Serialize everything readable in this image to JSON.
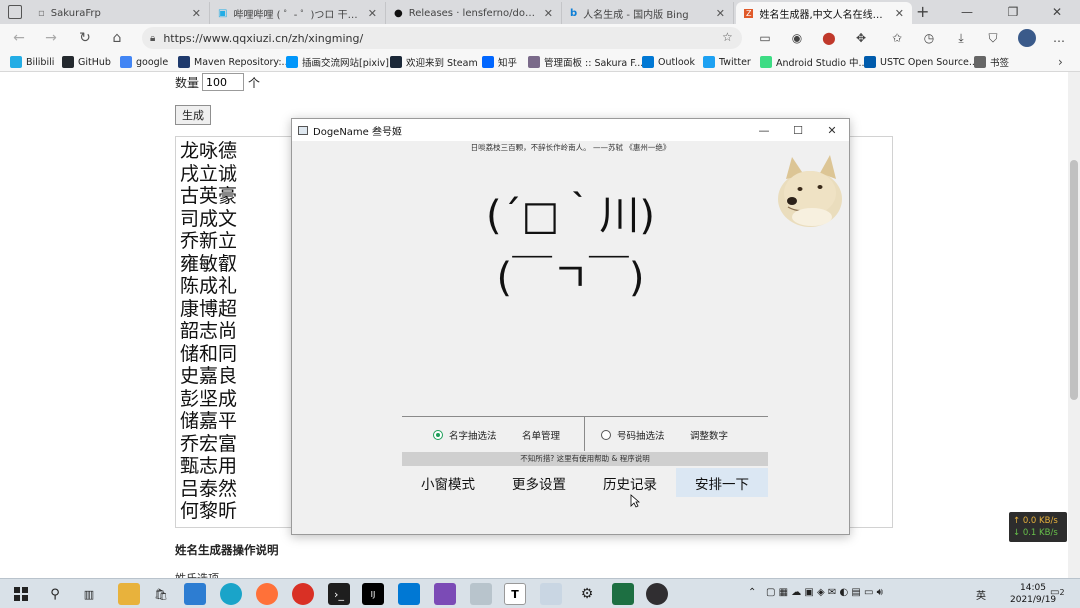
{
  "browser": {
    "tabs": [
      {
        "title": "SakuraFrp",
        "active": false
      },
      {
        "title": "哔哩哔哩 ( ゜- ゜)つロ 干杯~-bili",
        "active": false
      },
      {
        "title": "Releases · lensferno/dogename",
        "active": false
      },
      {
        "title": "人名生成 - 国内版 Bing",
        "active": false
      },
      {
        "title": "姓名生成器,中文人名在线生成,可",
        "active": true
      }
    ],
    "url": "https://www.qqxiuzi.cn/zh/xingming/",
    "bookmarks": [
      {
        "label": "Bilibili",
        "color": "#23ade5"
      },
      {
        "label": "GitHub",
        "color": "#24292e"
      },
      {
        "label": "google",
        "color": "#4285f4"
      },
      {
        "label": "Maven Repository:...",
        "color": "#1f3a6d"
      },
      {
        "label": "插画交流网站[pixiv]",
        "color": "#0096fa"
      },
      {
        "label": "欢迎来到 Steam",
        "color": "#1b2838"
      },
      {
        "label": "知乎",
        "color": "#0066ff"
      },
      {
        "label": "管理面板 :: Sakura F...",
        "color": "#7a6a8a"
      },
      {
        "label": "Outlook",
        "color": "#0078d4"
      },
      {
        "label": "Twitter",
        "color": "#1da1f2"
      },
      {
        "label": "Android Studio 中...",
        "color": "#3ddc84"
      },
      {
        "label": "USTC Open Source...",
        "color": "#005bac"
      },
      {
        "label": "书签",
        "color": "#666666"
      }
    ]
  },
  "page": {
    "qty_label": "数量",
    "qty_value": "100",
    "qty_unit": "个",
    "generate_label": "生成",
    "names": [
      "龙咏德",
      "戌立诚",
      "古英豪",
      "司成文",
      "乔新立",
      "雍敏叡",
      "陈成礼",
      "康博超",
      "韶志尚",
      "储和同",
      "史嘉良",
      "彭坚成",
      "储嘉平",
      "乔宏富",
      "甄志用",
      "吕泰然",
      "何黎昕"
    ],
    "section_title": "姓名生成器操作说明",
    "section_sub": "姓氏选项"
  },
  "app": {
    "title": "DogeName 叁号姬",
    "quote": "日啖荔枝三百颗，不辞长作岭南人。 ——苏轼 《惠州一绝》",
    "kaomoji_line1": "(´□｀川)",
    "kaomoji_line2": "(￣ㄱ￣)",
    "mode_name": "名字抽选法",
    "manage_names": "名单管理",
    "mode_number": "号码抽选法",
    "adjust_numbers": "调整数字",
    "help_text": "不知所措? 这里有使用帮助 & 程序说明",
    "buttons": {
      "mini": "小窗模式",
      "settings": "更多设置",
      "history": "历史记录",
      "arrange": "安排一下"
    }
  },
  "net": {
    "up": "↑ 0.0 KB/s",
    "down": "↓ 0.1 KB/s"
  },
  "taskbar": {
    "ime": "英",
    "time": "14:05",
    "date": "2021/9/19",
    "notify_count": "2"
  },
  "colors": {
    "accent_green": "#1e9e5a",
    "primary_button": "#dbe7f3"
  }
}
